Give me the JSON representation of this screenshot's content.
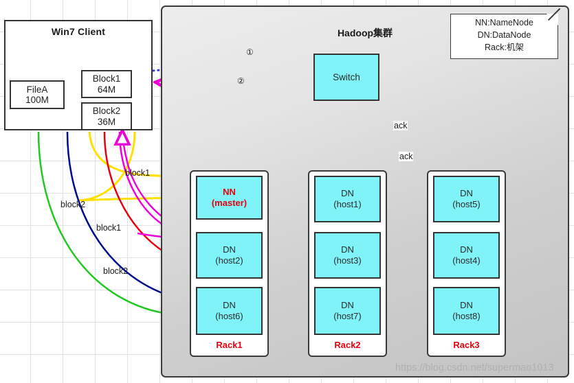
{
  "client": {
    "title": "Win7 Client",
    "file": {
      "name": "FileA",
      "size": "100M"
    },
    "blocks": [
      {
        "name": "Block1",
        "size": "64M"
      },
      {
        "name": "Block2",
        "size": "36M"
      }
    ]
  },
  "cluster": {
    "title": "Hadoop集群",
    "switch_label": "Switch",
    "racks": [
      {
        "label": "Rack1",
        "nodes": [
          {
            "line1": "NN",
            "line2": "(master)",
            "role": "master"
          },
          {
            "line1": "DN",
            "line2": "(host2)",
            "role": "datanode"
          },
          {
            "line1": "DN",
            "line2": "(host6)",
            "role": "datanode"
          }
        ]
      },
      {
        "label": "Rack2",
        "nodes": [
          {
            "line1": "DN",
            "line2": "(host1)",
            "role": "datanode"
          },
          {
            "line1": "DN",
            "line2": "(host3)",
            "role": "datanode"
          },
          {
            "line1": "DN",
            "line2": "(host7)",
            "role": "datanode"
          }
        ]
      },
      {
        "label": "Rack3",
        "nodes": [
          {
            "line1": "DN",
            "line2": "(host5)",
            "role": "datanode"
          },
          {
            "line1": "DN",
            "line2": "(host4)",
            "role": "datanode"
          },
          {
            "line1": "DN",
            "line2": "(host8)",
            "role": "datanode"
          }
        ]
      }
    ]
  },
  "legend_note": {
    "lines": [
      "NN:NameNode",
      "DN:DataNode",
      "Rack:机架"
    ]
  },
  "annotations": {
    "step1": "①",
    "step2": "②",
    "block_labels": [
      {
        "text": "block1",
        "color": "#ffe000"
      },
      {
        "text": "block2",
        "color": "#ffe000"
      },
      {
        "text": "block1",
        "color": "#e8000d"
      },
      {
        "text": "block2",
        "color": "#000a8c"
      }
    ],
    "ack_labels": [
      "ack",
      "ack"
    ]
  },
  "watermark": "https://blog.csdn.net/supermao1013",
  "colors": {
    "node_fill": "#7ff3f8",
    "node_stroke": "#333333",
    "cluster_bg_light": "#ededed",
    "cluster_bg_dark": "#c3c3c3",
    "accent_red": "#e8000d",
    "yellow": "#ffe000",
    "magenta": "#ef00d8",
    "green_dark": "#17a317",
    "green_bright": "#22d822",
    "navy": "#000a8c",
    "blue_dotted": "#3a3ad0",
    "pink_dotted": "#ee55cc"
  }
}
